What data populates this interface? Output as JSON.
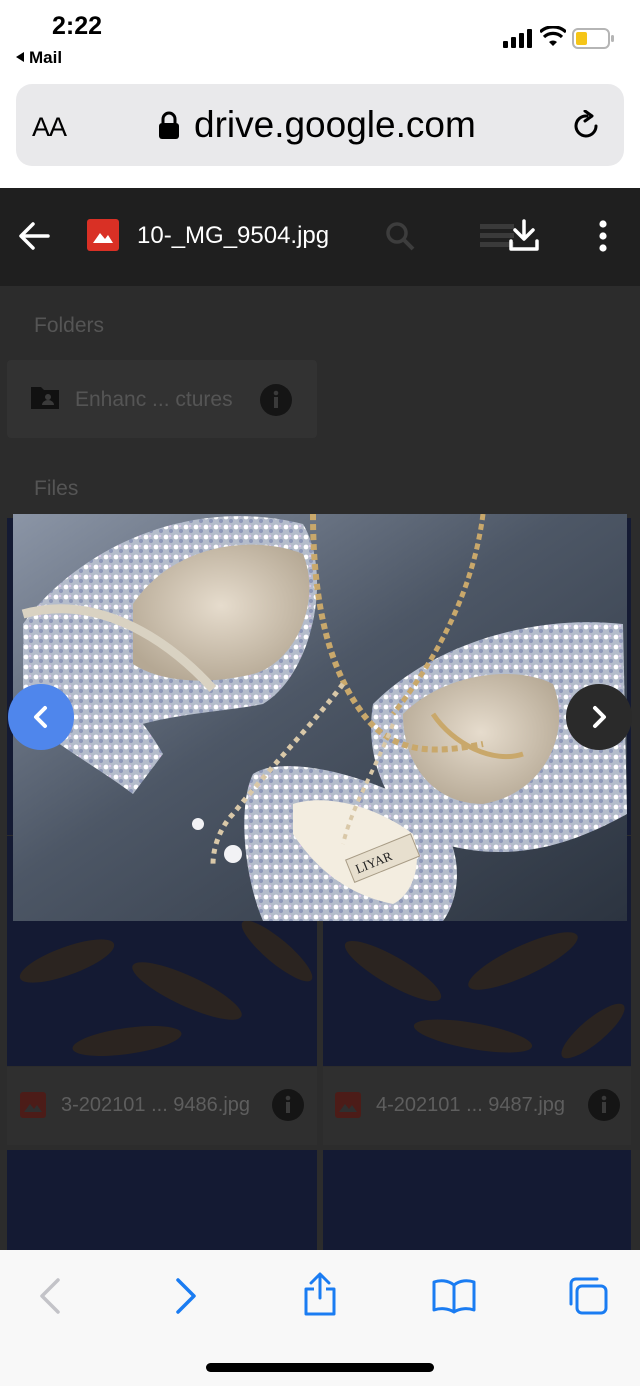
{
  "status_bar": {
    "time": "2:22",
    "back_label": "Mail"
  },
  "address_bar": {
    "text_size_label": "AA",
    "url": "drive.google.com"
  },
  "viewer": {
    "file_name": "10-_MG_9504.jpg",
    "preview_label": "LIYAR"
  },
  "background_listing": {
    "folders_heading": "Folders",
    "folder_name": "Enhanc ... ctures",
    "files_heading": "Files",
    "files": [
      {
        "name": "3-202101 ... 9486.jpg"
      },
      {
        "name": "4-202101 ... 9487.jpg"
      }
    ]
  },
  "colors": {
    "accent_blue": "#4f86ec",
    "ios_blue": "#1a7cf2",
    "image_file_red": "#d93025"
  }
}
